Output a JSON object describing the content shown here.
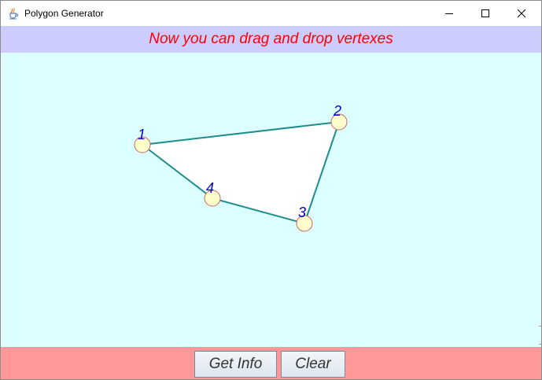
{
  "window": {
    "title": "Polygon Generator",
    "app_icon": "java-cup-icon",
    "controls": [
      "minimize-icon",
      "maximize-icon",
      "close-icon"
    ]
  },
  "header": {
    "message": "Now you can drag and drop vertexes",
    "text_color": "#ff0000",
    "background": "#ccccff"
  },
  "canvas": {
    "background": "#dcffff",
    "polygon_fill": "#ffffff",
    "edge_color": "#1e8c8c",
    "vertex_fill": "#ffffcc",
    "vertex_stroke": "#cc6666",
    "label_color": "#0000cc",
    "vertices": [
      {
        "label": "1"
      },
      {
        "label": "2"
      },
      {
        "label": "3"
      },
      {
        "label": "4"
      }
    ]
  },
  "footer": {
    "background": "#ff9999",
    "get_info_label": "Get Info",
    "clear_label": "Clear"
  }
}
